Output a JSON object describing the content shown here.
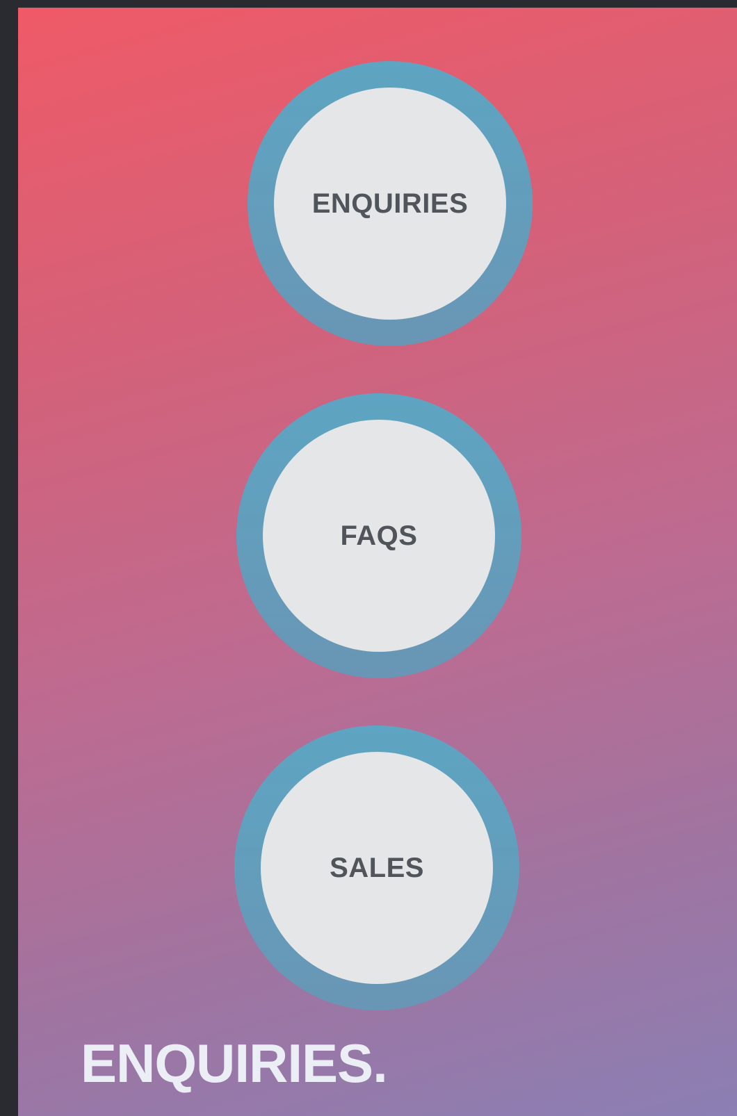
{
  "nav": {
    "items": [
      {
        "label": "ENQUIRIES"
      },
      {
        "label": "FAQS"
      },
      {
        "label": "SALES"
      }
    ]
  },
  "page": {
    "heading": "ENQUIRIES."
  },
  "colors": {
    "ring": "#6aa0bd",
    "circle_fill": "#e4e6e8",
    "label_text": "#50545b",
    "heading_text": "#eceef5",
    "gradient_top": "#ef5a67",
    "gradient_bottom": "#8b7fb4",
    "frame": "#2a2b30"
  }
}
